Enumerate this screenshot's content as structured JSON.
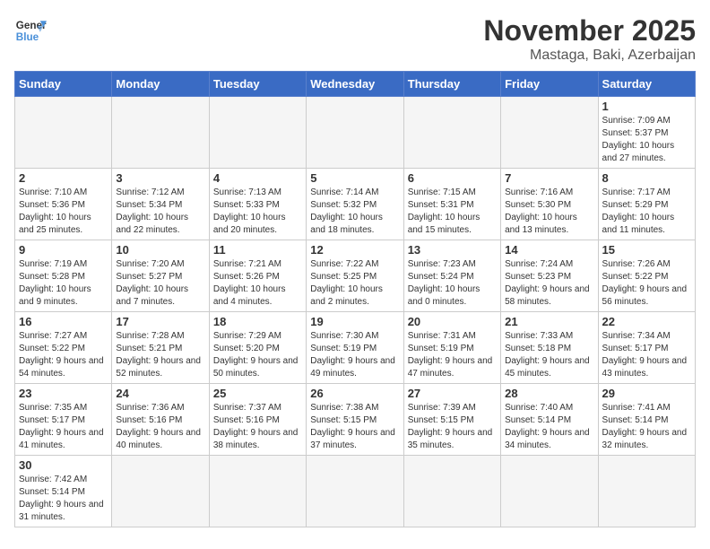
{
  "logo": {
    "text_general": "General",
    "text_blue": "Blue"
  },
  "title": "November 2025",
  "location": "Mastaga, Baki, Azerbaijan",
  "days_of_week": [
    "Sunday",
    "Monday",
    "Tuesday",
    "Wednesday",
    "Thursday",
    "Friday",
    "Saturday"
  ],
  "weeks": [
    [
      {
        "day": "",
        "info": ""
      },
      {
        "day": "",
        "info": ""
      },
      {
        "day": "",
        "info": ""
      },
      {
        "day": "",
        "info": ""
      },
      {
        "day": "",
        "info": ""
      },
      {
        "day": "",
        "info": ""
      },
      {
        "day": "1",
        "info": "Sunrise: 7:09 AM\nSunset: 5:37 PM\nDaylight: 10 hours and 27 minutes."
      }
    ],
    [
      {
        "day": "2",
        "info": "Sunrise: 7:10 AM\nSunset: 5:36 PM\nDaylight: 10 hours and 25 minutes."
      },
      {
        "day": "3",
        "info": "Sunrise: 7:12 AM\nSunset: 5:34 PM\nDaylight: 10 hours and 22 minutes."
      },
      {
        "day": "4",
        "info": "Sunrise: 7:13 AM\nSunset: 5:33 PM\nDaylight: 10 hours and 20 minutes."
      },
      {
        "day": "5",
        "info": "Sunrise: 7:14 AM\nSunset: 5:32 PM\nDaylight: 10 hours and 18 minutes."
      },
      {
        "day": "6",
        "info": "Sunrise: 7:15 AM\nSunset: 5:31 PM\nDaylight: 10 hours and 15 minutes."
      },
      {
        "day": "7",
        "info": "Sunrise: 7:16 AM\nSunset: 5:30 PM\nDaylight: 10 hours and 13 minutes."
      },
      {
        "day": "8",
        "info": "Sunrise: 7:17 AM\nSunset: 5:29 PM\nDaylight: 10 hours and 11 minutes."
      }
    ],
    [
      {
        "day": "9",
        "info": "Sunrise: 7:19 AM\nSunset: 5:28 PM\nDaylight: 10 hours and 9 minutes."
      },
      {
        "day": "10",
        "info": "Sunrise: 7:20 AM\nSunset: 5:27 PM\nDaylight: 10 hours and 7 minutes."
      },
      {
        "day": "11",
        "info": "Sunrise: 7:21 AM\nSunset: 5:26 PM\nDaylight: 10 hours and 4 minutes."
      },
      {
        "day": "12",
        "info": "Sunrise: 7:22 AM\nSunset: 5:25 PM\nDaylight: 10 hours and 2 minutes."
      },
      {
        "day": "13",
        "info": "Sunrise: 7:23 AM\nSunset: 5:24 PM\nDaylight: 10 hours and 0 minutes."
      },
      {
        "day": "14",
        "info": "Sunrise: 7:24 AM\nSunset: 5:23 PM\nDaylight: 9 hours and 58 minutes."
      },
      {
        "day": "15",
        "info": "Sunrise: 7:26 AM\nSunset: 5:22 PM\nDaylight: 9 hours and 56 minutes."
      }
    ],
    [
      {
        "day": "16",
        "info": "Sunrise: 7:27 AM\nSunset: 5:22 PM\nDaylight: 9 hours and 54 minutes."
      },
      {
        "day": "17",
        "info": "Sunrise: 7:28 AM\nSunset: 5:21 PM\nDaylight: 9 hours and 52 minutes."
      },
      {
        "day": "18",
        "info": "Sunrise: 7:29 AM\nSunset: 5:20 PM\nDaylight: 9 hours and 50 minutes."
      },
      {
        "day": "19",
        "info": "Sunrise: 7:30 AM\nSunset: 5:19 PM\nDaylight: 9 hours and 49 minutes."
      },
      {
        "day": "20",
        "info": "Sunrise: 7:31 AM\nSunset: 5:19 PM\nDaylight: 9 hours and 47 minutes."
      },
      {
        "day": "21",
        "info": "Sunrise: 7:33 AM\nSunset: 5:18 PM\nDaylight: 9 hours and 45 minutes."
      },
      {
        "day": "22",
        "info": "Sunrise: 7:34 AM\nSunset: 5:17 PM\nDaylight: 9 hours and 43 minutes."
      }
    ],
    [
      {
        "day": "23",
        "info": "Sunrise: 7:35 AM\nSunset: 5:17 PM\nDaylight: 9 hours and 41 minutes."
      },
      {
        "day": "24",
        "info": "Sunrise: 7:36 AM\nSunset: 5:16 PM\nDaylight: 9 hours and 40 minutes."
      },
      {
        "day": "25",
        "info": "Sunrise: 7:37 AM\nSunset: 5:16 PM\nDaylight: 9 hours and 38 minutes."
      },
      {
        "day": "26",
        "info": "Sunrise: 7:38 AM\nSunset: 5:15 PM\nDaylight: 9 hours and 37 minutes."
      },
      {
        "day": "27",
        "info": "Sunrise: 7:39 AM\nSunset: 5:15 PM\nDaylight: 9 hours and 35 minutes."
      },
      {
        "day": "28",
        "info": "Sunrise: 7:40 AM\nSunset: 5:14 PM\nDaylight: 9 hours and 34 minutes."
      },
      {
        "day": "29",
        "info": "Sunrise: 7:41 AM\nSunset: 5:14 PM\nDaylight: 9 hours and 32 minutes."
      }
    ],
    [
      {
        "day": "30",
        "info": "Sunrise: 7:42 AM\nSunset: 5:14 PM\nDaylight: 9 hours and 31 minutes."
      },
      {
        "day": "",
        "info": ""
      },
      {
        "day": "",
        "info": ""
      },
      {
        "day": "",
        "info": ""
      },
      {
        "day": "",
        "info": ""
      },
      {
        "day": "",
        "info": ""
      },
      {
        "day": "",
        "info": ""
      }
    ]
  ]
}
